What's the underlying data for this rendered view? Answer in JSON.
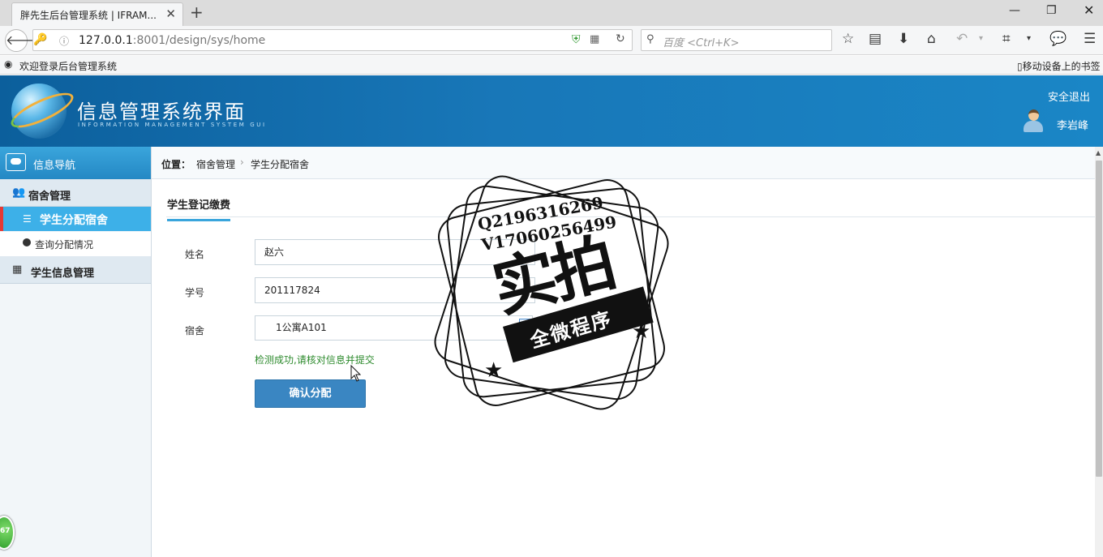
{
  "browser": {
    "tab_title": "胖先生后台管理系统 | IFRAM...",
    "tab_close": "✕",
    "new_tab": "+",
    "url_host": "127.0.0.1",
    "url_rest": ":8001/design/sys/home",
    "search_placeholder": "百度 <Ctrl+K>",
    "bookmark_left": "欢迎登录后台管理系统",
    "bookmark_right": "移动设备上的书签"
  },
  "header": {
    "title": "信息管理系统界面",
    "subtitle": "INFORMATION MANAGEMENT SYSTEM GUI",
    "logout": "安全退出",
    "username": "李岩峰"
  },
  "sidebar": {
    "head": "信息导航",
    "groups": [
      {
        "label": "宿舍管理",
        "icon": "people-icon"
      },
      {
        "label": "学生信息管理",
        "icon": "calendar-icon"
      }
    ],
    "items": [
      {
        "label": "学生分配宿舍",
        "active": true
      },
      {
        "label": "查询分配情况",
        "active": false
      }
    ]
  },
  "breadcrumb": {
    "label": "位置：",
    "level1": "宿舍管理",
    "sep": "›",
    "level2": "学生分配宿舍"
  },
  "panel": {
    "tab": "学生登记缴费"
  },
  "form": {
    "name_label": "姓名",
    "name_value": "赵六",
    "id_label": "学号",
    "id_value": "201117824",
    "dorm_label": "宿舍",
    "dorm_value": "1公寓A101",
    "check_message": "检测成功,请核对信息并提交",
    "submit": "确认分配"
  },
  "watermark": {
    "line1": "Q2196316269",
    "line2": "V17060256499",
    "big": "实拍",
    "ribbon": "全微程序"
  },
  "badge": {
    "text": "67"
  },
  "colors": {
    "header_blue": "#1877b8",
    "sidebar_active": "#3db0e8",
    "success_green": "#2e8b2e",
    "button_blue": "#3a86c2"
  }
}
